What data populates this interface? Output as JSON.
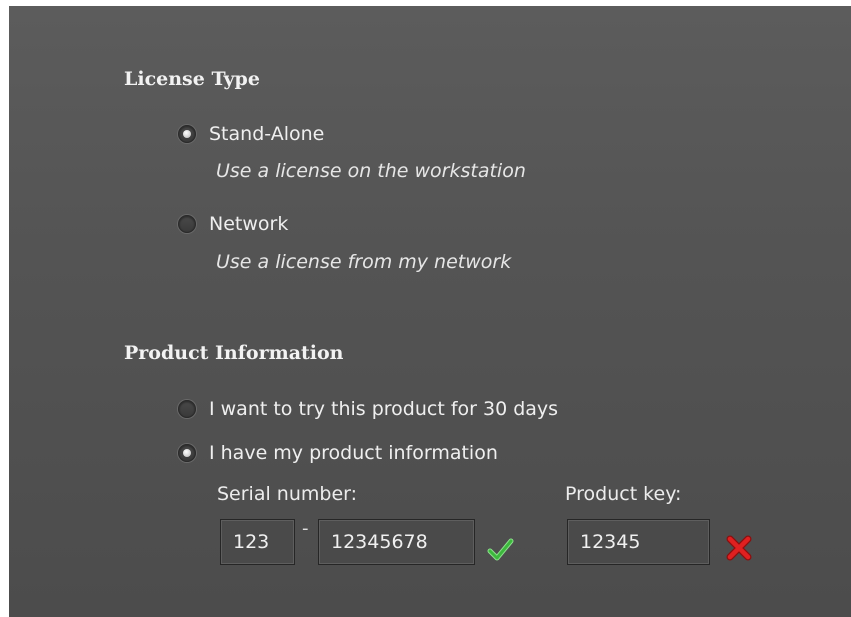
{
  "license_type": {
    "title": "License Type",
    "options": [
      {
        "label": "Stand-Alone",
        "hint": "Use a license on the workstation",
        "selected": true
      },
      {
        "label": "Network",
        "hint": "Use a license from my network",
        "selected": false
      }
    ]
  },
  "product_info": {
    "title": "Product Information",
    "options": [
      {
        "label": "I want to try this product for 30 days",
        "selected": false
      },
      {
        "label": "I have my product information",
        "selected": true
      }
    ],
    "serial_label": "Serial number:",
    "serial_prefix": "123",
    "serial_separator": "-",
    "serial_number": "12345678",
    "serial_status": "valid-check-icon",
    "product_key_label": "Product key:",
    "product_key": "12345",
    "product_key_status": "invalid-x-icon"
  },
  "colors": {
    "valid": "#3db83d",
    "invalid": "#e02020"
  }
}
